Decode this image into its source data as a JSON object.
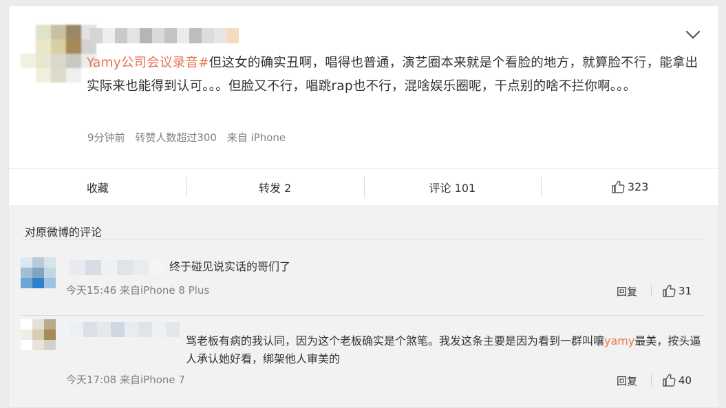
{
  "post": {
    "author_name": "",
    "hashtag": "Yamy公司会议录音",
    "hash_mark": "#",
    "text": "但这女的确实丑啊，唱得也普通，演艺圈本来就是个看脸的地方，就算脸不行，能拿出实际来也能得到认可。。。但脸又不行，唱跳rap也不行，混啥娱乐圈呢，干点别的啥不拦你啊。。。",
    "time": "9分钟前",
    "repost_info": "转赞人数超过300",
    "source": "来自 iPhone"
  },
  "actions": {
    "favorite": "收藏",
    "repost": "转发 2",
    "comment": "评论 101",
    "like_count": "323"
  },
  "comments_section": {
    "title": "对原微博的评论",
    "items": [
      {
        "text": "终于碰见说实话的哥们了",
        "time": "今天15:46 来自iPhone 8 Plus",
        "reply": "回复",
        "likes": "31"
      },
      {
        "text_before": "骂老板有病的我认同，因为这个老板确实是个煞笔。我发这条主要是因为看到一群叫嚷",
        "mention": "yamy",
        "text_after": "最美，按头逼人承认她好看，绑架他人审美的",
        "time": "今天17:08 来自iPhone 7",
        "reply": "回复",
        "likes": "40"
      }
    ]
  },
  "icons": {
    "menu": "chevron-down-icon",
    "like": "thumbs-up-icon"
  },
  "colors": {
    "link": "#eb7350",
    "meta": "#808080",
    "background": "#ececec"
  }
}
